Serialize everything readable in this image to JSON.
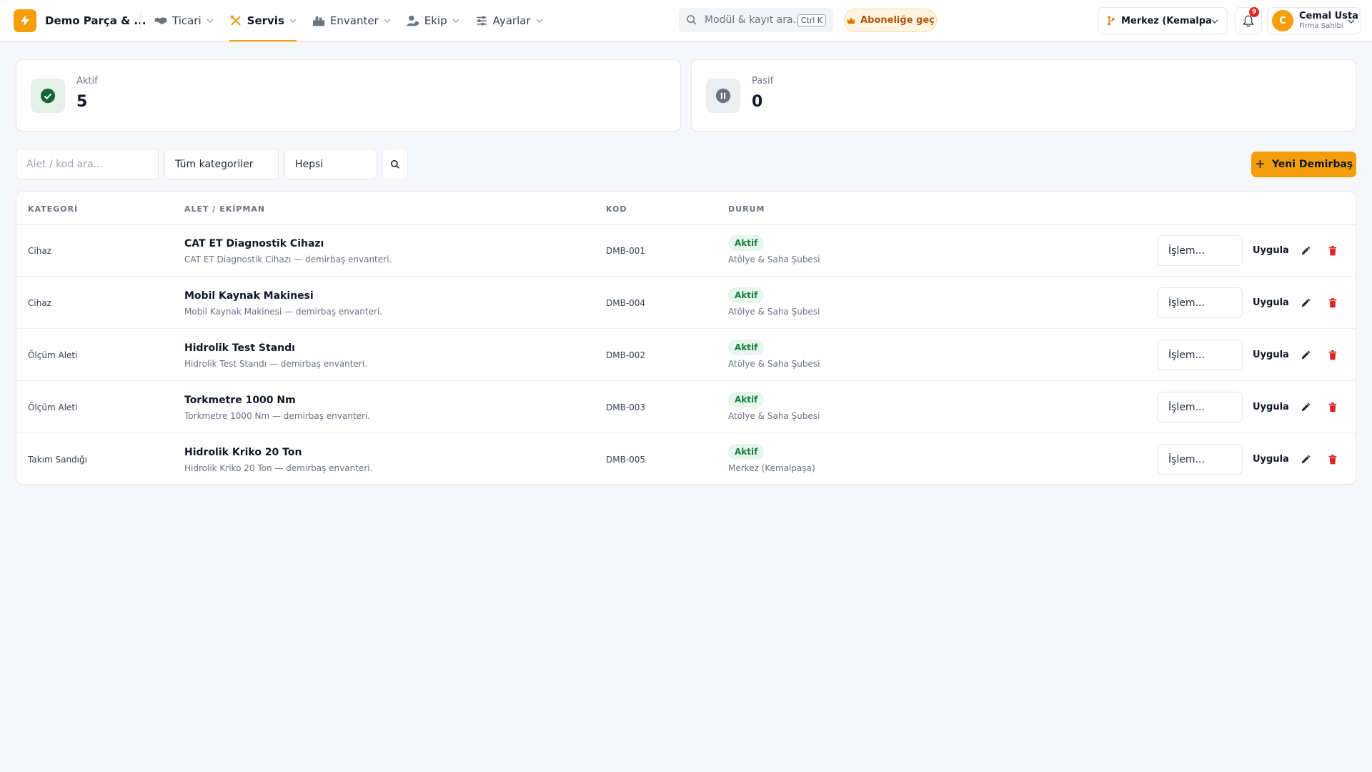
{
  "brand": {
    "name": "Demo Parça & ...",
    "logo_icon": "lightning-icon",
    "color": "#f59e0b"
  },
  "nav": {
    "items": [
      {
        "label": "Ticari",
        "icon": "handshake-icon",
        "active": false
      },
      {
        "label": "Servis",
        "icon": "tools-icon",
        "active": true
      },
      {
        "label": "Envanter",
        "icon": "warehouse-icon",
        "active": false
      },
      {
        "label": "Ekip",
        "icon": "team-icon",
        "active": false
      },
      {
        "label": "Ayarlar",
        "icon": "sliders-icon",
        "active": false
      }
    ]
  },
  "search": {
    "placeholder": "Modül & kayıt ara...",
    "shortcut": "Ctrl K"
  },
  "subscribe": {
    "label": "Aboneliğe geç",
    "icon": "crown-icon"
  },
  "branch": {
    "label": "Merkez (Kemalpa...",
    "icon": "branch-icon"
  },
  "notifications": {
    "count": "9"
  },
  "user": {
    "initial": "C",
    "name": "Cemal Usta",
    "role": "Firma Sahibi"
  },
  "stats": {
    "active": {
      "label": "Aktif",
      "value": "5",
      "icon": "check-circle-icon"
    },
    "passive": {
      "label": "Pasif",
      "value": "0",
      "icon": "pause-circle-icon"
    }
  },
  "filters": {
    "search_placeholder": "Alet / kod ara...",
    "category": "Tüm kategoriler",
    "status": "Hepsi"
  },
  "new_button": {
    "label": "Yeni Demirbaş"
  },
  "table": {
    "columns": {
      "category": "KATEGORİ",
      "tool": "ALET / EKİPMAN",
      "code": "KOD",
      "status": "DURUM"
    },
    "rows": [
      {
        "category": "Cihaz",
        "name": "CAT ET Diagnostik Cihazı",
        "desc": "CAT ET Diagnostik Cihazı — demirbaş envanteri.",
        "code": "DMB-001",
        "status": "Aktif",
        "branch": "Atölye & Saha Şubesi",
        "op_placeholder": "İşlem...",
        "apply": "Uygula"
      },
      {
        "category": "Cihaz",
        "name": "Mobil Kaynak Makinesi",
        "desc": "Mobil Kaynak Makinesi — demirbaş envanteri.",
        "code": "DMB-004",
        "status": "Aktif",
        "branch": "Atölye & Saha Şubesi",
        "op_placeholder": "İşlem...",
        "apply": "Uygula"
      },
      {
        "category": "Ölçüm Aleti",
        "name": "Hidrolik Test Standı",
        "desc": "Hidrolik Test Standı — demirbaş envanteri.",
        "code": "DMB-002",
        "status": "Aktif",
        "branch": "Atölye & Saha Şubesi",
        "op_placeholder": "İşlem...",
        "apply": "Uygula"
      },
      {
        "category": "Ölçüm Aleti",
        "name": "Torkmetre 1000 Nm",
        "desc": "Torkmetre 1000 Nm — demirbaş envanteri.",
        "code": "DMB-003",
        "status": "Aktif",
        "branch": "Atölye & Saha Şubesi",
        "op_placeholder": "İşlem...",
        "apply": "Uygula"
      },
      {
        "category": "Takım Sandığı",
        "name": "Hidrolik Kriko 20 Ton",
        "desc": "Hidrolik Kriko 20 Ton — demirbaş envanteri.",
        "code": "DMB-005",
        "status": "Aktif",
        "branch": "Merkez (Kemalpaşa)",
        "op_placeholder": "İşlem...",
        "apply": "Uygula"
      }
    ]
  },
  "colors": {
    "accent": "#f59e0b",
    "success": "#15803d",
    "danger": "#dc2626"
  }
}
